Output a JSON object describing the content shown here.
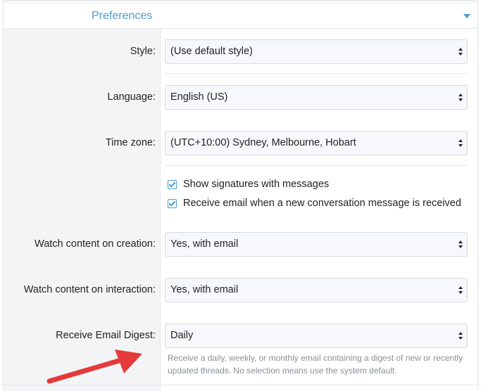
{
  "header": {
    "title": "Preferences",
    "toggle_icon": "caret-down-icon"
  },
  "rows": {
    "style": {
      "label": "Style:",
      "value": "(Use default style)"
    },
    "language": {
      "label": "Language:",
      "value": "English (US)"
    },
    "timezone": {
      "label": "Time zone:",
      "value": "(UTC+10:00) Sydney, Melbourne, Hobart"
    },
    "watch_creation": {
      "label": "Watch content on creation:",
      "value": "Yes, with email"
    },
    "watch_interaction": {
      "label": "Watch content on interaction:",
      "value": "Yes, with email"
    },
    "email_digest": {
      "label": "Receive Email Digest:",
      "value": "Daily",
      "hint": "Receive a daily, weekly, or monthly email containing a digest of new or recently updated threads. No selection means use the system default."
    }
  },
  "checkboxes": {
    "signatures": {
      "label": "Show signatures with messages",
      "checked": true
    },
    "conversation_email": {
      "label": "Receive email when a new conversation message is received",
      "checked": true
    }
  },
  "colors": {
    "accent": "#4a9bd1",
    "annotation_arrow": "#e5393a"
  }
}
